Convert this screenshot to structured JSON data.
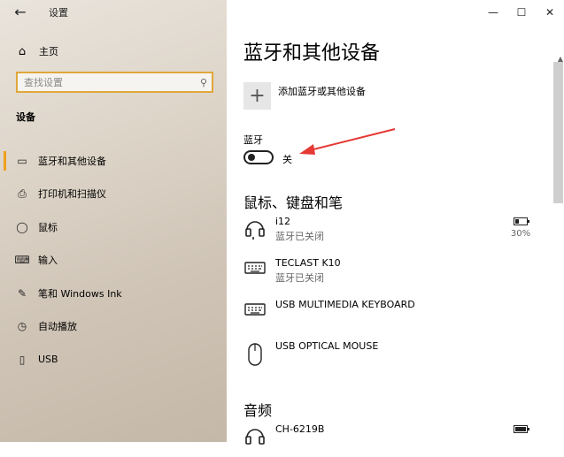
{
  "window": {
    "title": "设置",
    "back_icon": "back-arrow-icon",
    "controls": {
      "minimize": "—",
      "maximize": "☐",
      "close": "✕"
    }
  },
  "sidebar": {
    "home_label": "主页",
    "search_placeholder": "查找设置",
    "section_label": "设备",
    "items": [
      {
        "label": "蓝牙和其他设备",
        "icon": "bluetooth-devices-icon",
        "active": true
      },
      {
        "label": "打印机和扫描仪",
        "icon": "printer-icon",
        "active": false
      },
      {
        "label": "鼠标",
        "icon": "mouse-icon",
        "active": false
      },
      {
        "label": "输入",
        "icon": "keyboard-icon",
        "active": false
      },
      {
        "label": "笔和 Windows Ink",
        "icon": "pen-icon",
        "active": false
      },
      {
        "label": "自动播放",
        "icon": "autoplay-icon",
        "active": false
      },
      {
        "label": "USB",
        "icon": "usb-icon",
        "active": false
      }
    ]
  },
  "main": {
    "title": "蓝牙和其他设备",
    "add_device_label": "添加蓝牙或其他设备",
    "bluetooth": {
      "label": "蓝牙",
      "state": "关"
    },
    "section_mice": "鼠标、键盘和笔",
    "devices": [
      {
        "name": "i12",
        "status": "蓝牙已关闭",
        "icon": "headset-icon",
        "battery": "30%"
      },
      {
        "name": "TECLAST K10",
        "status": "蓝牙已关闭",
        "icon": "keyboard-icon"
      },
      {
        "name": "USB MULTIMEDIA KEYBOARD",
        "status": "",
        "icon": "keyboard-icon"
      },
      {
        "name": "USB OPTICAL MOUSE",
        "status": "",
        "icon": "mouse-icon"
      }
    ],
    "section_audio": "音频",
    "audio_devices": [
      {
        "name": "CH-6219B",
        "icon": "headset-icon"
      }
    ]
  },
  "colors": {
    "accent": "#f0a11d",
    "annotation_arrow": "#e53935"
  }
}
